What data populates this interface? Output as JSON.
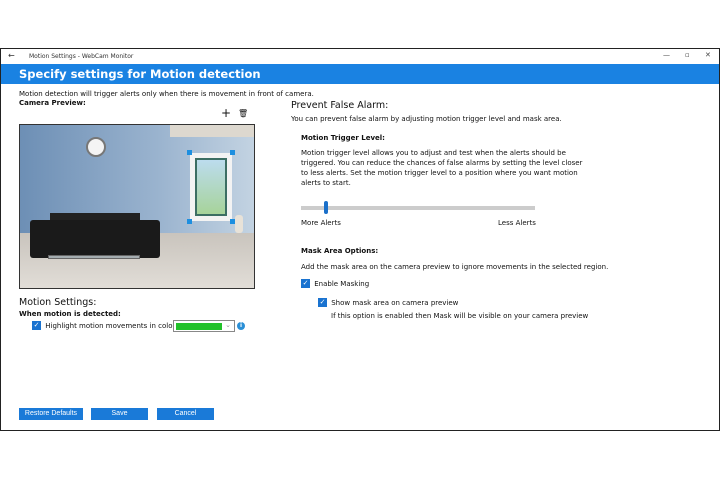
{
  "window": {
    "title": "Motion Settings - WebCam Monitor",
    "back": "←",
    "minimize": "—",
    "maximize": "▫",
    "close": "✕"
  },
  "header": {
    "title": "Specify settings for Motion detection"
  },
  "intro": "Motion detection will trigger alerts only when there is movement in front of camera.",
  "camera": {
    "label": "Camera Preview:",
    "add_icon": "+",
    "delete_icon": "🗑"
  },
  "motion": {
    "title": "Motion Settings:",
    "subtitle": "When motion is detected:",
    "highlight_label": "Highlight motion movements in color:",
    "highlight_checked": true,
    "highlight_color": "#22c12a",
    "info": "i"
  },
  "prevent": {
    "title": "Prevent False Alarm:",
    "desc": "You can prevent false alarm by adjusting motion trigger level and mask area."
  },
  "trigger": {
    "title": "Motion Trigger Level:",
    "desc": "Motion trigger level allows you to adjust and test when the alerts should be triggered. You can reduce the chances of false alarms by setting the level closer to less alerts. Set the motion trigger level to a position where you want motion alerts to start.",
    "value_percent": 10,
    "min_label": "More Alerts",
    "max_label": "Less Alerts"
  },
  "mask": {
    "title": "Mask Area Options:",
    "desc": "Add the mask area on the camera preview to ignore movements in the selected region.",
    "enable_label": "Enable Masking",
    "show_label": "Show mask area on camera preview",
    "show_note": "If this option is enabled then Mask will be visible on your camera preview"
  },
  "buttons": {
    "restore": "Restore Defaults",
    "save": "Save",
    "cancel": "Cancel"
  },
  "check_glyph": "✓"
}
